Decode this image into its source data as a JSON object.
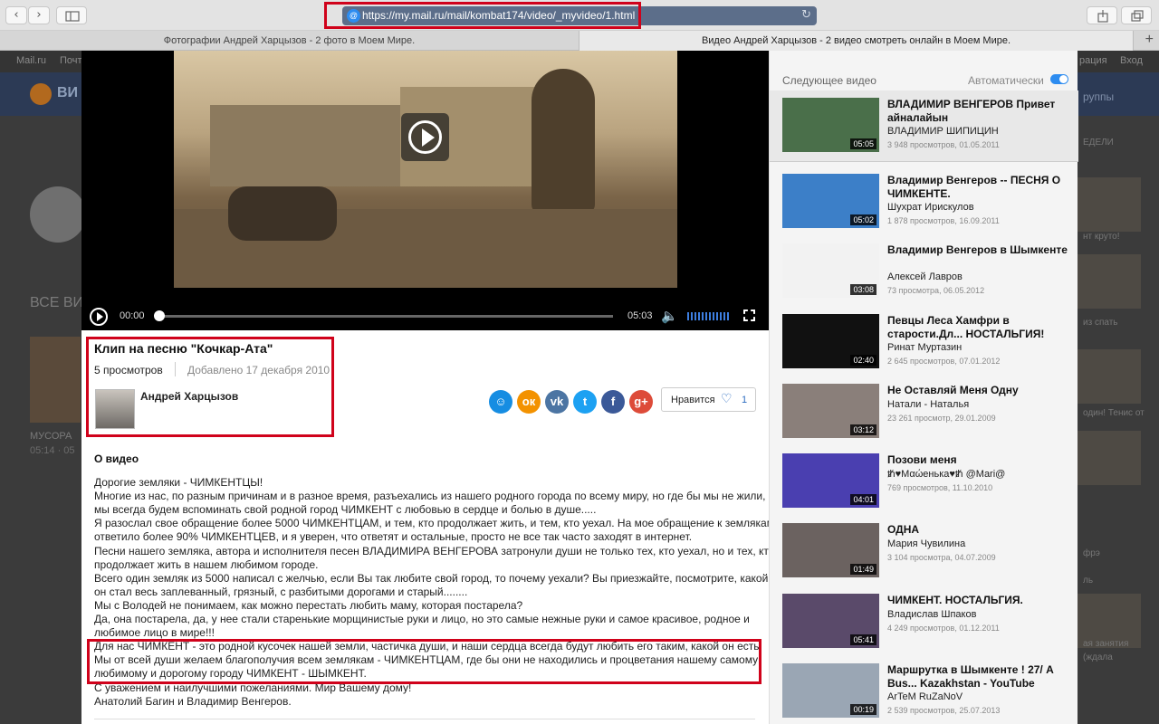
{
  "browser": {
    "url": "https://my.mail.ru/mail/kombat174/video/_myvideo/1.html",
    "tabs": [
      {
        "title": "Фотографии Андрей Харцызов - 2 фото в Моем Мире."
      },
      {
        "title": "Видео Андрей Харцызов - 2 видео смотреть онлайн в Моем Мире."
      }
    ],
    "new_tab": "+"
  },
  "background_page": {
    "topbar": [
      "Mail.ru",
      "Почт",
      "рация",
      "Вход"
    ],
    "logo_text": "ВИ",
    "header_right": "руппы",
    "section_title": "ВСЕ ВИ",
    "caption": "МУСОРА",
    "caption2": "05:14 · 05",
    "side_snippets": [
      "ЕДЕЛИ",
      "нт круто!",
      "из спать",
      "один! Тенис от",
      "фрэ",
      "ль",
      "ая занятия",
      "(ждала"
    ]
  },
  "player": {
    "current_time": "00:00",
    "duration": "05:03",
    "progress": 0,
    "volume": 0.9
  },
  "video": {
    "title": "Клип на песню \"Кочкар-Ата\"",
    "views": "5 просмотров",
    "added": "Добавлено 17 декабря 2010",
    "author": "Андрей Харцызов",
    "like_label": "Нравится",
    "like_count": "1",
    "about_heading": "О видео",
    "description": [
      "Дорогие земляки - ЧИМКЕНТЦЫ!",
      "Многие из нас, по разным причинам и в разное время, разъехались из нашего родного города по всему миру, но где бы мы не жили,",
      "мы всегда будем вспоминать свой родной город ЧИМКЕНТ с любовью в сердце и болью в душе.....",
      "Я разослал свое обращение более 5000 ЧИМКЕНТЦАМ, и тем, кто продолжает жить, и тем, кто уехал. На мое обращение к землякам",
      "ответило более 90% ЧИМКЕНТЦЕВ, и я уверен, что ответят и остальные, просто не все так часто заходят в интернет.",
      "Песни нашего земляка, автора и исполнителя песен ВЛАДИМИРА ВЕНГЕРОВА затронули души не только тех, кто уехал, но и тех, кто",
      "продолжает жить в нашем любимом городе.",
      "Всего один земляк из 5000 написал с желчью, если Вы так любите свой город, то почему уехали? Вы приезжайте, посмотрите, какой",
      "он стал весь заплеванный, грязный, с разбитыми дорогами и старый........",
      "Мы с Володей не понимаем, как можно перестать любить маму, которая постарела?",
      "Да, она постарела, да, у нее стали старенькие морщинистые руки и лицо, но это самые нежные руки и самое красивое, родное и",
      "любимое лицо в мире!!!",
      "Для нас ЧИМКЕНТ - это родной кусочек нашей земли, частичка души, и наши сердца всегда будут любить его таким, какой он есть.",
      "Мы от всей души желаем благополучия всем землякам - ЧИМКЕНТЦАМ, где бы они не находились и процветания нашему самому",
      "любимому и дорогому городу ЧИМКЕНТ - ШЫМКЕНТ.",
      "С уважением и наилучшими пожеланиями. Мир Вашему дому!",
      "Анатолий Багин и Владимир Венгеров."
    ]
  },
  "sidebar": {
    "next_label": "Следующее видео",
    "auto_label": "Автоматически",
    "auto_enabled": true,
    "items": [
      {
        "title": "ВЛАДИМИР ВЕНГЕРОВ Привет айналайын",
        "author": "ВЛАДИМИР ШИПИЦИН",
        "meta": "3 948 просмотров, 01.05.2011",
        "duration": "05:05",
        "thumb_color": "#4a6f4a"
      },
      {
        "title": "Владимир Венгеров -- ПЕСНЯ О ЧИМКЕНТЕ.",
        "author": "Шухрат Ирискулов",
        "meta": "1 878 просмотров, 16.09.2011",
        "duration": "05:02",
        "thumb_color": "#3c7fc8"
      },
      {
        "title": "Владимир Венгеров в Шымкенте",
        "author": "Алексей Лавров",
        "meta": "73 просмотра, 06.05.2012",
        "duration": "03:08",
        "thumb_color": "#f2f2f2"
      },
      {
        "title": "Певцы Леса Хамфри в старости.Дл... НОСТАЛЬГИЯ!",
        "author": "Ринат Муртазин",
        "meta": "2 645 просмотров, 07.01.2012",
        "duration": "02:40",
        "thumb_color": "#111111"
      },
      {
        "title": "Не Оставляй Меня Одну",
        "author": "Натали - Наталья",
        "meta": "23 261 просмотр, 29.01.2009",
        "duration": "03:12",
        "thumb_color": "#8a7f7a"
      },
      {
        "title": "Позови меня",
        "author": "ᵺ♥Мαώенька♥ᵺ @Mari@",
        "meta": "769 просмотров, 11.10.2010",
        "duration": "04:01",
        "thumb_color": "#4a3fb0"
      },
      {
        "title": "ОДНА",
        "author": "Мария Чувилина",
        "meta": "3 104 просмотра, 04.07.2009",
        "duration": "01:49",
        "thumb_color": "#6b6260"
      },
      {
        "title": "ЧИМКЕНТ. НОСТАЛЬГИЯ.",
        "author": "Владислав Шпаков",
        "meta": "4 249 просмотров, 01.12.2011",
        "duration": "05:41",
        "thumb_color": "#5a4a6a"
      },
      {
        "title": "Маршрутка в Шымкенте ! 27/ A Bus... Kazakhstan - YouTube",
        "author": "ArTeM RuZaNoV",
        "meta": "2 539 просмотров, 25.07.2013",
        "duration": "00:19",
        "thumb_color": "#9aa6b4"
      }
    ]
  },
  "colors": {
    "accent_blue": "#2d8cf0",
    "highlight_red": "#d0021b"
  },
  "icons": {
    "share": [
      "mail-smile-icon",
      "odnoklassniki-icon",
      "vkontakte-icon",
      "twitter-icon",
      "facebook-icon",
      "google-plus-icon"
    ]
  }
}
